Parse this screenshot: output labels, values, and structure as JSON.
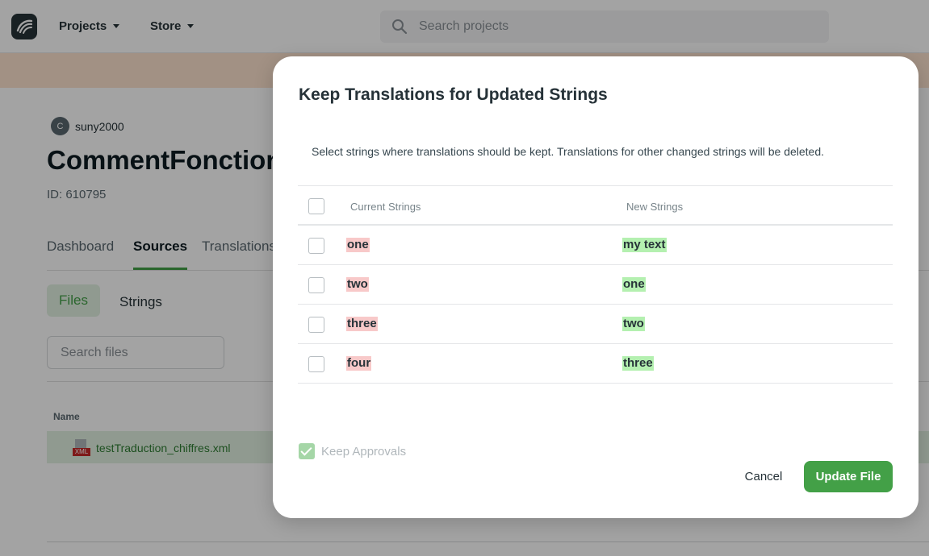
{
  "header": {
    "nav": [
      {
        "label": "Projects"
      },
      {
        "label": "Store"
      }
    ],
    "search_placeholder": "Search projects"
  },
  "project": {
    "owner_initial": "C",
    "owner": "suny2000",
    "title": "CommentFonction",
    "id": "ID: 610795",
    "tabs": [
      "Dashboard",
      "Sources",
      "Translations"
    ],
    "active_tab": "Sources",
    "subtabs": [
      "Files",
      "Strings"
    ],
    "search_files_placeholder": "Search files",
    "files_column": "Name",
    "file_name": "testTraduction_chiffres.xml",
    "file_type": "XML"
  },
  "modal": {
    "title": "Keep Translations for Updated Strings",
    "description": "Select strings where translations should be kept. Translations for other changed strings will be deleted.",
    "columns": {
      "current": "Current Strings",
      "new": "New Strings"
    },
    "rows": [
      {
        "current": "one",
        "new": "my text"
      },
      {
        "current": "two",
        "new": "one"
      },
      {
        "current": "three",
        "new": "two"
      },
      {
        "current": "four",
        "new": "three"
      }
    ],
    "keep_approvals_label": "Keep Approvals",
    "cancel_label": "Cancel",
    "update_label": "Update File"
  },
  "colors": {
    "accent": "#43a047",
    "removed_highlight": "#f8c9c9",
    "added_highlight": "#b4f0b0",
    "banner": "#fde3cf"
  }
}
